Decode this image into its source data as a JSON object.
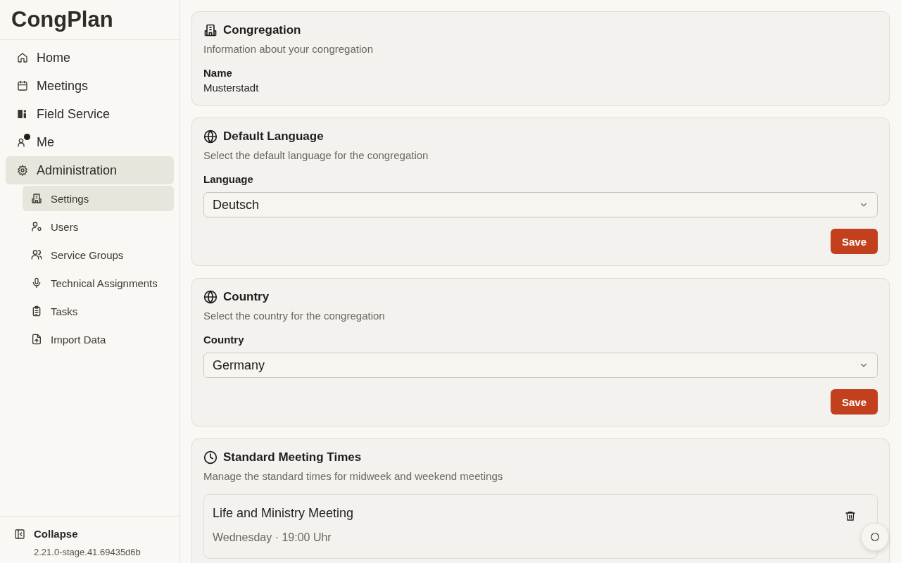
{
  "app": {
    "title": "CongPlan"
  },
  "sidebar": {
    "items": [
      {
        "label": "Home",
        "selected": false,
        "notification": false
      },
      {
        "label": "Meetings",
        "selected": false,
        "notification": false
      },
      {
        "label": "Field Service",
        "selected": false,
        "notification": false
      },
      {
        "label": "Me",
        "selected": false,
        "notification": true
      },
      {
        "label": "Administration",
        "selected": true,
        "notification": false,
        "expanded": true,
        "children": [
          {
            "label": "Settings",
            "selected": true
          },
          {
            "label": "Users",
            "selected": false
          },
          {
            "label": "Service Groups",
            "selected": false
          },
          {
            "label": "Technical Assignments",
            "selected": false
          },
          {
            "label": "Tasks",
            "selected": false
          },
          {
            "label": "Import Data",
            "selected": false
          }
        ]
      }
    ],
    "collapse": "Collapse",
    "version": "2.21.0-stage.41.69435d6b"
  },
  "sections": [
    {
      "kind": "info",
      "title": "Congregation",
      "description": "Information about your congregation",
      "label": "Name",
      "value": "Musterstadt"
    },
    {
      "kind": "select",
      "title": "Default Language",
      "description": "Select the default language for the congregation",
      "label": "Language",
      "value": "Deutsch",
      "button": "Save"
    },
    {
      "kind": "select",
      "title": "Country",
      "description": "Select the country for the congregation",
      "label": "Country",
      "value": "Germany",
      "button": "Save"
    },
    {
      "kind": "meetings",
      "title": "Standard Meeting Times",
      "description": "Manage the standard times for midweek and weekend meetings",
      "meetings": [
        {
          "title": "Life and Ministry Meeting",
          "time": "Wednesday · 19:00 Uhr"
        }
      ]
    }
  ]
}
